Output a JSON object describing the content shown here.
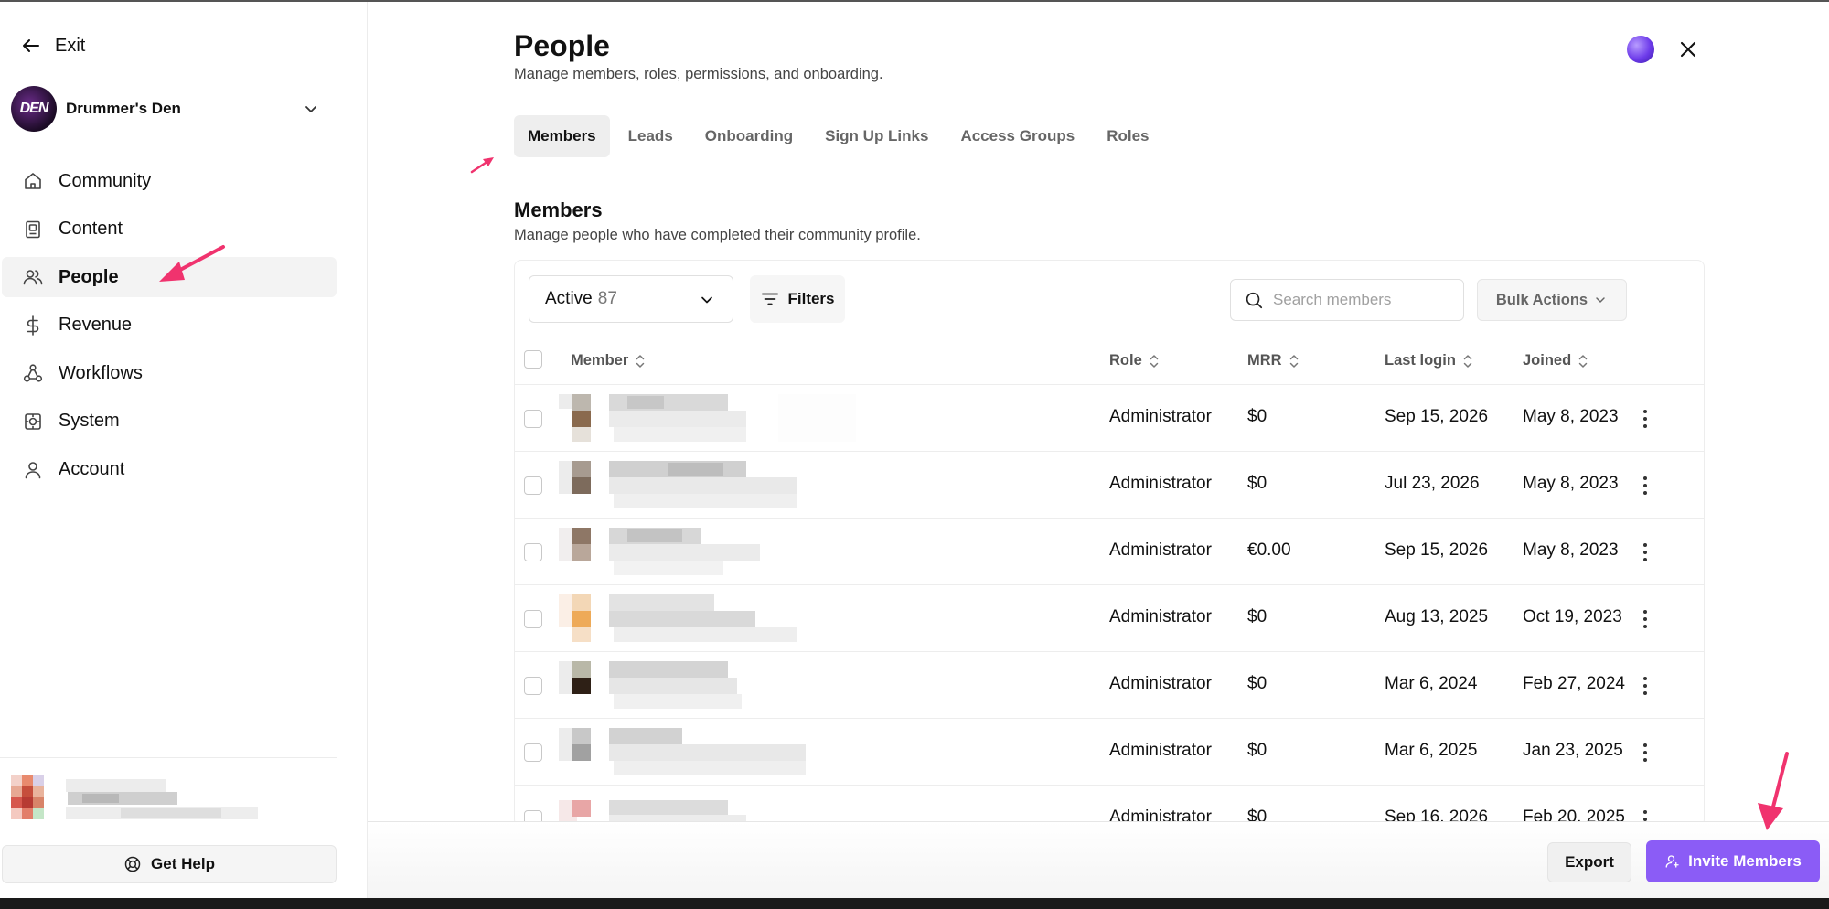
{
  "sidebar": {
    "exit_label": "Exit",
    "community_name": "Drummer's Den",
    "community_logo_text": "DEN",
    "items": [
      {
        "label": "Community",
        "icon": "home-icon"
      },
      {
        "label": "Content",
        "icon": "content-icon"
      },
      {
        "label": "People",
        "icon": "people-icon"
      },
      {
        "label": "Revenue",
        "icon": "dollar-icon"
      },
      {
        "label": "Workflows",
        "icon": "workflow-icon"
      },
      {
        "label": "System",
        "icon": "gear-icon"
      },
      {
        "label": "Account",
        "icon": "user-icon"
      }
    ],
    "active_item": "People",
    "help_label": "Get Help"
  },
  "header": {
    "title": "People",
    "subtitle": "Manage members, roles, permissions, and onboarding."
  },
  "tabs": [
    {
      "label": "Members",
      "active": true
    },
    {
      "label": "Leads",
      "active": false
    },
    {
      "label": "Onboarding",
      "active": false
    },
    {
      "label": "Sign Up Links",
      "active": false
    },
    {
      "label": "Access Groups",
      "active": false
    },
    {
      "label": "Roles",
      "active": false
    }
  ],
  "section": {
    "title": "Members",
    "subtitle": "Manage people who have completed their community profile."
  },
  "toolbar": {
    "status_label": "Active",
    "status_count": "87",
    "filters_label": "Filters",
    "search_placeholder": "Search members",
    "bulk_label": "Bulk Actions"
  },
  "table": {
    "columns": [
      "Member",
      "Role",
      "MRR",
      "Last login",
      "Joined"
    ],
    "rows": [
      {
        "role": "Administrator",
        "mrr": "$0",
        "last_login": "Sep 15, 2026",
        "joined": "May 8, 2023"
      },
      {
        "role": "Administrator",
        "mrr": "$0",
        "last_login": "Jul 23, 2026",
        "joined": "May 8, 2023"
      },
      {
        "role": "Administrator",
        "mrr": "€0.00",
        "last_login": "Sep 15, 2026",
        "joined": "May 8, 2023"
      },
      {
        "role": "Administrator",
        "mrr": "$0",
        "last_login": "Aug 13, 2025",
        "joined": "Oct 19, 2023"
      },
      {
        "role": "Administrator",
        "mrr": "$0",
        "last_login": "Mar 6, 2024",
        "joined": "Feb 27, 2024"
      },
      {
        "role": "Administrator",
        "mrr": "$0",
        "last_login": "Mar 6, 2025",
        "joined": "Jan 23, 2025"
      },
      {
        "role": "Administrator",
        "mrr": "$0",
        "last_login": "Sep 16, 2026",
        "joined": "Feb 20, 2025"
      }
    ]
  },
  "footer": {
    "export_label": "Export",
    "invite_label": "Invite Members"
  },
  "colors": {
    "accent": "#8b5cf6",
    "annotation": "#f0336e"
  }
}
